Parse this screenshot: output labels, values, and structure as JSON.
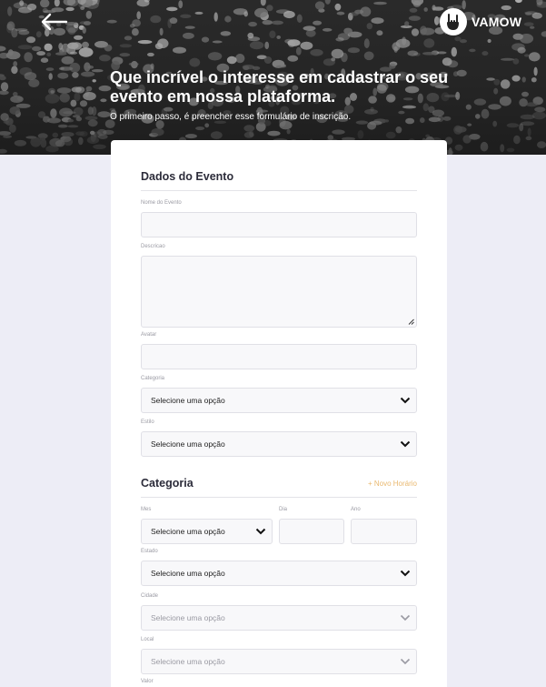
{
  "header": {
    "back_icon": "arrow-left-icon",
    "logo_text": "VAMOW",
    "logo_icon": "rock-hand-icon",
    "title": "Que incrível o interesse em cadastrar o seu evento em nossa plataforma.",
    "subtitle": "O primeiro passo, é preencher esse formulário de inscrição."
  },
  "form": {
    "event_section": {
      "title": "Dados do Evento",
      "name_label": "Nome do Evento",
      "description_label": "Descricao",
      "banner_label": "Avatar",
      "category_label": "Categoria",
      "category_value": "Selecione uma opção",
      "style_label": "Estilo",
      "style_value": "Selecione uma opção"
    },
    "schedule_section": {
      "title": "Categoria",
      "add_link": "+ Novo Horário",
      "month_label": "Mes",
      "month_value": "Selecione uma opção",
      "day_label": "Dia",
      "year_label": "Ano",
      "state_label": "Estado",
      "state_value": "Selecione uma opção",
      "city_label": "Cidade",
      "city_value": "Selecione uma opção",
      "venue_label": "Local",
      "venue_value": "Selecione uma opção",
      "price_label": "Valor"
    }
  },
  "colors": {
    "page_bg": "#ededf6",
    "accent": "#e9b86f",
    "hero_bg": "#2e2e2e"
  }
}
